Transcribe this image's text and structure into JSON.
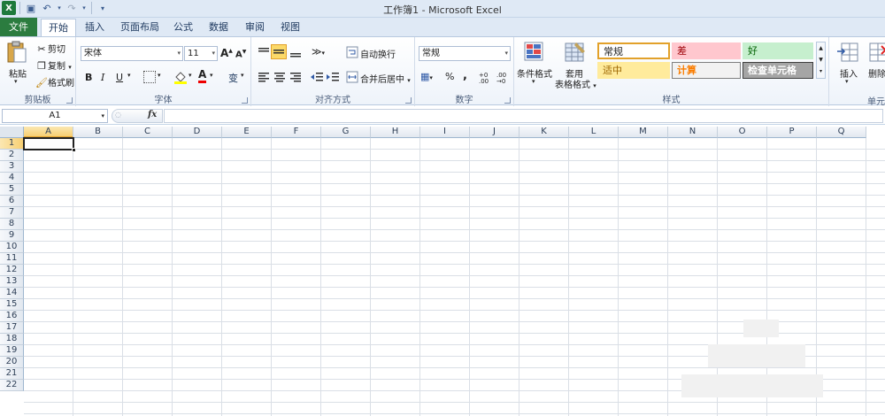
{
  "window": {
    "title": "工作簿1 - Microsoft Excel"
  },
  "tabs": [
    "文件",
    "开始",
    "插入",
    "页面布局",
    "公式",
    "数据",
    "审阅",
    "视图"
  ],
  "clipboard": {
    "paste": "粘贴",
    "cut": "剪切",
    "copy": "复制",
    "format_painter": "格式刷",
    "label": "剪贴板"
  },
  "font": {
    "name": "宋体",
    "size": "11",
    "grow": "A",
    "shrink": "A",
    "bold": "B",
    "italic": "I",
    "underline": "U",
    "color_letter": "A",
    "phonetic": "变",
    "label": "字体"
  },
  "alignment": {
    "wrap": "自动换行",
    "merge": "合并后居中",
    "label": "对齐方式"
  },
  "number": {
    "format": "常规",
    "percent": "%",
    "comma": ",",
    "inc_decimal": ".0←.00",
    "dec_decimal": ".00→.0",
    "label": "数字"
  },
  "styles": {
    "conditional": "条件格式",
    "table_line1": "套用",
    "table_line2": "表格格式",
    "cells": [
      {
        "text": "常规",
        "bg": "#ffffff",
        "fg": "#222222",
        "border": "#e2a12a"
      },
      {
        "text": "差",
        "bg": "#ffc7ce",
        "fg": "#9c0006",
        "border": "#ffc7ce"
      },
      {
        "text": "好",
        "bg": "#c6efce",
        "fg": "#006100",
        "border": "#c6efce"
      },
      {
        "text": "适中",
        "bg": "#ffeb9c",
        "fg": "#9c6500",
        "border": "#ffeb9c"
      },
      {
        "text": "计算",
        "bg": "#f2f2f2",
        "fg": "#fa7d00",
        "border": "#7f7f7f"
      },
      {
        "text": "检查单元格",
        "bg": "#a5a5a5",
        "fg": "#ffffff",
        "border": "#3f3f3f"
      }
    ],
    "label": "样式"
  },
  "cells_group": {
    "insert": "插入",
    "delete": "删除",
    "label": "单元格"
  },
  "formula_bar": {
    "name_box": "A1",
    "fx": "fx"
  },
  "grid": {
    "columns": [
      "A",
      "B",
      "C",
      "D",
      "E",
      "F",
      "G",
      "H",
      "I",
      "J",
      "K",
      "L",
      "M",
      "N",
      "O",
      "P",
      "Q"
    ],
    "rows": [
      "1",
      "2",
      "3",
      "4",
      "5",
      "6",
      "7",
      "8",
      "9",
      "10",
      "11",
      "12",
      "13",
      "14",
      "15",
      "16",
      "17",
      "18",
      "19",
      "20",
      "21",
      "22"
    ]
  }
}
